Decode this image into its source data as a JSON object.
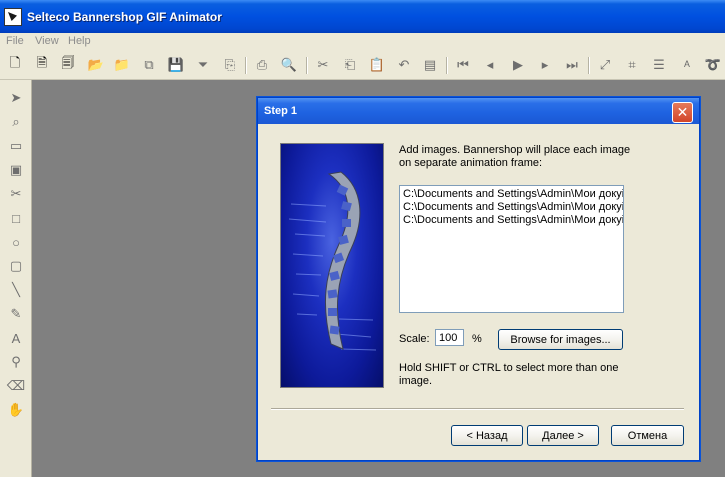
{
  "app": {
    "title": "Selteco Bannershop GIF Animator"
  },
  "menu": [
    "File",
    "View",
    "Help"
  ],
  "toolbar": {
    "buttons": [
      {
        "name": "new-doc-icon",
        "glyph": "🗋",
        "active": true
      },
      {
        "name": "new-wizard-icon",
        "glyph": "🗎",
        "active": true
      },
      {
        "name": "new-template-icon",
        "glyph": "🗐",
        "active": true
      },
      {
        "name": "open-folder-icon",
        "glyph": "📂",
        "active": true
      },
      {
        "name": "open-green-folder-icon",
        "glyph": "📁",
        "active": true
      },
      {
        "name": "copy-frames-icon",
        "glyph": "⧉",
        "active": false
      },
      {
        "name": "save-icon",
        "glyph": "💾",
        "active": false
      },
      {
        "name": "filter-icon",
        "glyph": "⏷",
        "active": false
      },
      {
        "name": "export-icon",
        "glyph": "⎘",
        "active": false
      },
      {
        "name": "print-icon",
        "glyph": "⎙",
        "active": false
      },
      {
        "name": "print-preview-icon",
        "glyph": "🔍",
        "active": false
      },
      {
        "name": "cut-icon",
        "glyph": "✂",
        "active": false
      },
      {
        "name": "copy-icon",
        "glyph": "⎗",
        "active": false
      },
      {
        "name": "paste-icon",
        "glyph": "📋",
        "active": false
      },
      {
        "name": "undo-icon",
        "glyph": "↶",
        "active": false
      },
      {
        "name": "frames-icon",
        "glyph": "▤",
        "active": false
      },
      {
        "name": "first-frame-icon",
        "glyph": "⏮",
        "active": false
      },
      {
        "name": "prev-frame-icon",
        "glyph": "◂",
        "active": false
      },
      {
        "name": "play-icon",
        "glyph": "▶",
        "active": false
      },
      {
        "name": "next-frame-icon",
        "glyph": "▸",
        "active": false
      },
      {
        "name": "last-frame-icon",
        "glyph": "⏭",
        "active": false
      },
      {
        "name": "fit-icon",
        "glyph": "⤢",
        "active": false
      },
      {
        "name": "crop-icon",
        "glyph": "⌗",
        "active": false
      },
      {
        "name": "layers-icon",
        "glyph": "☰",
        "active": false
      },
      {
        "name": "text-tool-icon",
        "glyph": "ᴬ",
        "active": false
      },
      {
        "name": "lasso-icon",
        "glyph": "➰",
        "active": false
      }
    ]
  },
  "tools": [
    {
      "name": "arrow-tool-icon",
      "glyph": "➤"
    },
    {
      "name": "zoom-tool-icon",
      "glyph": "⌕"
    },
    {
      "name": "frame-tool-icon",
      "glyph": "▭"
    },
    {
      "name": "image-tool-icon",
      "glyph": "▣"
    },
    {
      "name": "scissors-tool-icon",
      "glyph": "✂"
    },
    {
      "name": "rectangle-tool-icon",
      "glyph": "□"
    },
    {
      "name": "ellipse-tool-icon",
      "glyph": "○"
    },
    {
      "name": "rounded-rect-tool-icon",
      "glyph": "▢"
    },
    {
      "name": "line-tool-icon",
      "glyph": "╲"
    },
    {
      "name": "pencil-tool-icon",
      "glyph": "✎"
    },
    {
      "name": "text-tool-icon",
      "glyph": "A"
    },
    {
      "name": "eyedropper-tool-icon",
      "glyph": "⚲"
    },
    {
      "name": "eraser-tool-icon",
      "glyph": "⌫"
    },
    {
      "name": "hand-tool-icon",
      "glyph": "✋"
    }
  ],
  "dialog": {
    "title": "Step 1",
    "instructions": "Add images. Bannershop will place each image on separate animation frame:",
    "files": [
      "C:\\Documents and Settings\\Admin\\Мои докуі",
      "C:\\Documents and Settings\\Admin\\Мои докуі",
      "C:\\Documents and Settings\\Admin\\Мои докуі"
    ],
    "scale_label": "Scale:",
    "scale_value": "100",
    "percent_label": "%",
    "browse_label": "Browse for images...",
    "hint": "Hold SHIFT or CTRL to select more than one image.",
    "back_label": "< Назад",
    "next_label": "Далее >",
    "cancel_label": "Отмена"
  },
  "colors": {
    "titlebar": "#0054e3",
    "workspace": "#808080",
    "dialog_face": "#ece9d8"
  }
}
